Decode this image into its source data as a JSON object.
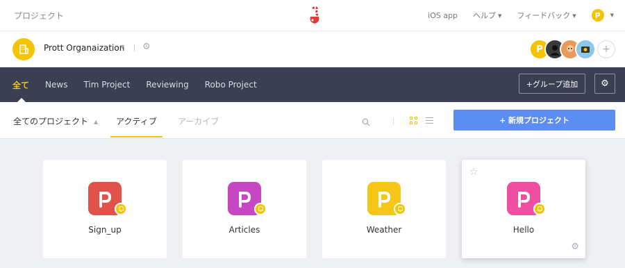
{
  "topbar": {
    "brand": "プロジェクト",
    "links": [
      {
        "label": "iOS app",
        "caret": false
      },
      {
        "label": "ヘルプ",
        "caret": true
      },
      {
        "label": "フィードバック",
        "caret": true
      }
    ],
    "user_avatar_letter": "P"
  },
  "org": {
    "name": "Prott Organaization",
    "members": [
      {
        "kind": "prott",
        "color": "#f5c400",
        "letter": "P"
      },
      {
        "kind": "person",
        "color": "#3a3a3a"
      },
      {
        "kind": "person",
        "color": "#e89a5a"
      },
      {
        "kind": "person",
        "color": "#8ec7e8"
      }
    ],
    "add_member": "+"
  },
  "group_nav": {
    "tabs": [
      {
        "label": "全て",
        "active": true
      },
      {
        "label": "News",
        "active": false
      },
      {
        "label": "Tim Project",
        "active": false
      },
      {
        "label": "Reviewing",
        "active": false
      },
      {
        "label": "Robo Project",
        "active": false
      }
    ],
    "add_group_label": "+グループ追加"
  },
  "filter": {
    "all_projects_label": "全てのプロジェクト",
    "status_tabs": [
      {
        "label": "アクティブ",
        "active": true
      },
      {
        "label": "アーカイブ",
        "active": false
      }
    ],
    "new_project_label": "+ 新規プロジェクト"
  },
  "projects": [
    {
      "name": "Sign_up",
      "color": "#e0524a",
      "featured": false
    },
    {
      "name": "Articles",
      "color": "#c646c4",
      "featured": false
    },
    {
      "name": "Weather",
      "color": "#f5c518",
      "featured": false
    },
    {
      "name": "Hello",
      "color": "#ee4fa0",
      "featured": true
    }
  ],
  "colors": {
    "accent": "#f5c400",
    "nav_bg": "#3a3f52",
    "primary_button": "#5b8ef0"
  }
}
